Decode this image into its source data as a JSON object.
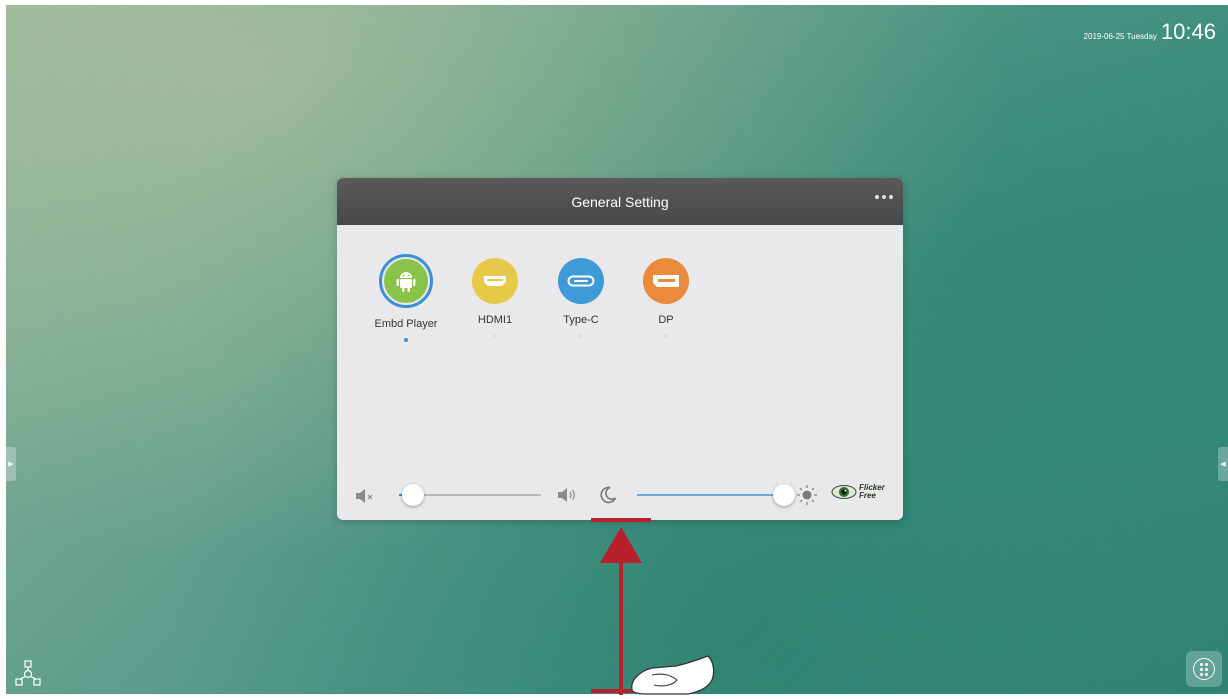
{
  "status_bar": {
    "date": "2019-06-25 Tuesday",
    "time": "10:46"
  },
  "panel": {
    "title": "General Setting",
    "sources": [
      {
        "label": "Embd Player",
        "icon": "android-icon",
        "color": "#8bc34a",
        "active": true
      },
      {
        "label": "HDMI1",
        "icon": "hdmi-icon",
        "color": "#e8c848",
        "active": false
      },
      {
        "label": "Type-C",
        "icon": "usb-c-icon",
        "color": "#3f9ad8",
        "active": false
      },
      {
        "label": "DP",
        "icon": "displayport-icon",
        "color": "#ea8a3c",
        "active": false
      }
    ],
    "volume_level": 0.1,
    "brightness_level": 0.98,
    "flicker_free": {
      "line1": "Flicker",
      "line2": "Free"
    }
  },
  "colors": {
    "accent": "#3b8fd8",
    "header": "#4f4f4f",
    "annotation": "#b8202e"
  }
}
